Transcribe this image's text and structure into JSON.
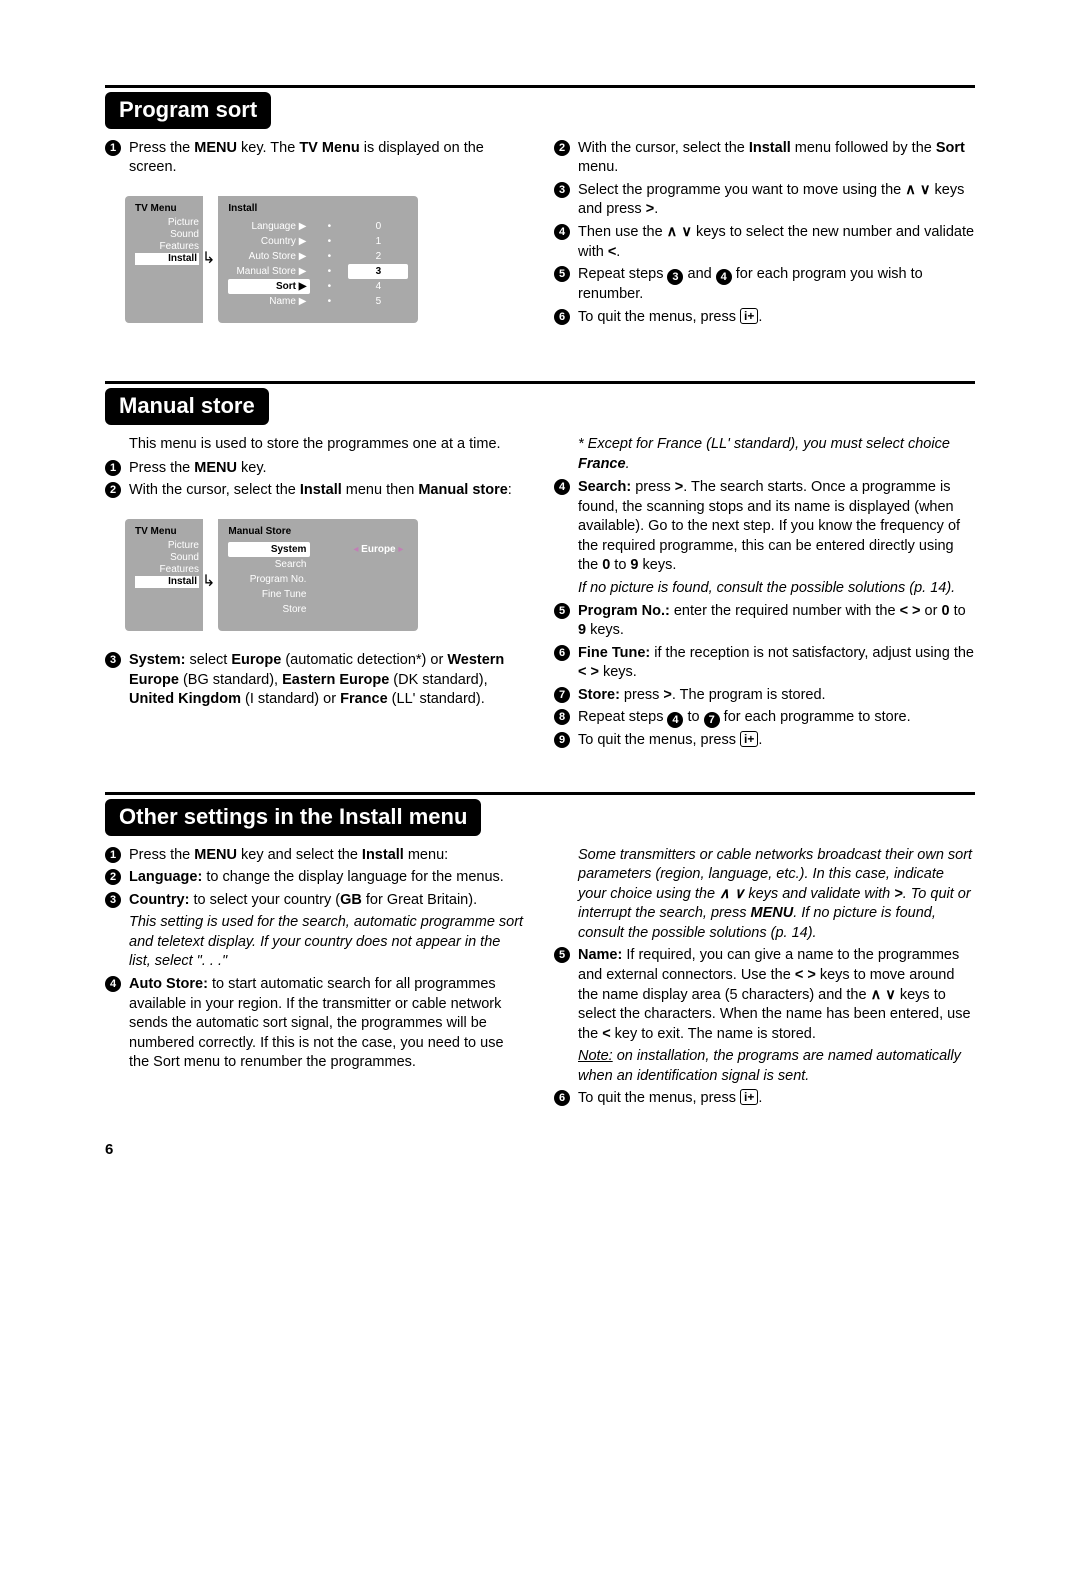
{
  "page_number": "6",
  "sections": {
    "program_sort": {
      "heading": "Program sort",
      "left": {
        "steps": [
          {
            "n": "1",
            "html": "Press the <b>MENU</b> key. The <b>TV Menu</b> is displayed on the screen."
          }
        ],
        "osd": {
          "tv_title": "TV Menu",
          "tv_items": [
            "Picture",
            "Sound",
            "Features",
            "Install"
          ],
          "tv_selected_index": 3,
          "main_title": "Install",
          "rows": [
            {
              "label": "Language ▶",
              "dot": "•",
              "val": "0"
            },
            {
              "label": "Country ▶",
              "dot": "•",
              "val": "1"
            },
            {
              "label": "Auto Store ▶",
              "dot": "•",
              "val": "2"
            },
            {
              "label": "Manual Store ▶",
              "dot": "•",
              "val": "3",
              "hl": true
            },
            {
              "label": "Sort ▶",
              "dot": "•",
              "val": "4",
              "sel": true
            },
            {
              "label": "Name ▶",
              "dot": "•",
              "val": "5"
            }
          ]
        }
      },
      "right_steps": [
        {
          "n": "2",
          "html": "With the cursor, select the <b>Install</b> menu followed by the <b>Sort</b> menu."
        },
        {
          "n": "3",
          "html": "Select the programme you want to move using the <b>∧ ∨</b> keys and press <b>&gt;</b>."
        },
        {
          "n": "4",
          "html": "Then use the <b>∧ ∨</b> keys to select the new number and validate with <b>&lt;</b>."
        },
        {
          "n": "5",
          "html": "Repeat steps <span class=\"inline-num\">3</span> and <span class=\"inline-num\">4</span> for each program you wish to renumber."
        },
        {
          "n": "6",
          "html": "To quit the menus, press <span class=\"kbox\">i+</span>."
        }
      ]
    },
    "manual_store": {
      "heading": "Manual store",
      "left": {
        "intro": "This menu is used to store the programmes one at a time.",
        "steps_before": [
          {
            "n": "1",
            "html": "Press the <b>MENU</b> key."
          },
          {
            "n": "2",
            "html": "With the cursor, select the <b>Install</b> menu then <b>Manual store</b>:"
          }
        ],
        "osd": {
          "tv_title": "TV Menu",
          "tv_items": [
            "Picture",
            "Sound",
            "Features",
            "Install"
          ],
          "tv_selected_index": 3,
          "main_title": "Manual Store",
          "rows": [
            {
              "label": "System",
              "val_html": "<span style=\"color:#c27fb6\">◂</span> <b style=\"color:#fff\">Europe</b> <span style=\"color:#c27fb6\">▸</span>",
              "sel": true
            },
            {
              "label": "Search",
              "val": ""
            },
            {
              "label": "Program No.",
              "val": ""
            },
            {
              "label": "Fine Tune",
              "val": ""
            },
            {
              "label": "Store",
              "val": ""
            }
          ]
        },
        "steps_after": [
          {
            "n": "3",
            "html": "<b>System:</b> select <b>Europe</b> (automatic detection*) or <b>Western Europe</b> (BG standard), <b>Eastern Europe</b> (DK standard), <b>United Kingdom</b> (I standard) or <b>France</b> (LL' standard)."
          }
        ]
      },
      "right": {
        "note_top": "* Except for France (LL' standard), you must select choice <b>France</b>.",
        "steps": [
          {
            "n": "4",
            "html": "<b>Search:</b> press <b>&gt;</b>. The search starts. Once a programme is found, the scanning stops and its name is displayed (when available). Go to the next step. If you know the frequency of the required programme, this can be entered directly using the <b>0</b> to <b>9</b> keys."
          },
          {
            "italic": true,
            "html": "If no picture is found, consult the possible solutions (p. 14)."
          },
          {
            "n": "5",
            "html": "<b>Program No.:</b> enter the required number with the <b>&lt; &gt;</b> or <b>0</b> to <b>9</b> keys."
          },
          {
            "n": "6",
            "html": "<b>Fine Tune:</b> if the reception is not satisfactory, adjust using the <b>&lt; &gt;</b> keys."
          },
          {
            "n": "7",
            "html": "<b>Store:</b> press <b>&gt;</b>. The program is stored."
          },
          {
            "n": "8",
            "html": "Repeat steps <span class=\"inline-num\">4</span> to <span class=\"inline-num\">7</span> for each programme to store."
          },
          {
            "n": "9",
            "html": "To quit the menus, press <span class=\"kbox\">i+</span>."
          }
        ]
      }
    },
    "other": {
      "heading": "Other settings in the Install menu",
      "left_steps": [
        {
          "n": "1",
          "html": "Press the <b>MENU</b> key and select the <b>Install</b> menu:"
        },
        {
          "n": "2",
          "html": "<b>Language:</b> to change the display language for the menus."
        },
        {
          "n": "3",
          "html": "<b>Country:</b> to select your country (<b>GB</b> for Great Britain)."
        },
        {
          "italic": true,
          "html": "This setting is used for the search, automatic programme sort and teletext display. If your country does not appear in the list, select \". . .\""
        },
        {
          "n": "4",
          "html": "<b>Auto Store:</b> to start automatic search for all programmes available in your region. If the transmitter or cable network sends the automatic sort signal, the programmes will be numbered correctly. If this is not the case, you need to use the Sort menu to renumber the programmes."
        }
      ],
      "right_steps": [
        {
          "italic": true,
          "html": "Some transmitters or cable networks broadcast their own sort parameters (region, language, etc.). In this case, indicate your choice using the <b>∧ ∨</b> keys and validate with <b>&gt;</b>. To quit or interrupt the search, press <b>MENU</b>. If no picture is found, consult the possible solutions (p. 14)."
        },
        {
          "n": "5",
          "html": "<b>Name:</b> If required, you can give a name to the programmes and external connectors. Use the <b>&lt; &gt;</b> keys to move around the name display area (5 characters) and the <b>∧ ∨</b> keys to select the characters. When the name has been entered, use the <b>&lt;</b> key to exit. The name is stored."
        },
        {
          "italic": true,
          "html": "<span class=\"underline\">Note:</span> on installation, the programs are named automatically when an identification signal is sent."
        },
        {
          "n": "6",
          "html": "To quit the menus, press <span class=\"kbox\">i+</span>."
        }
      ]
    }
  }
}
